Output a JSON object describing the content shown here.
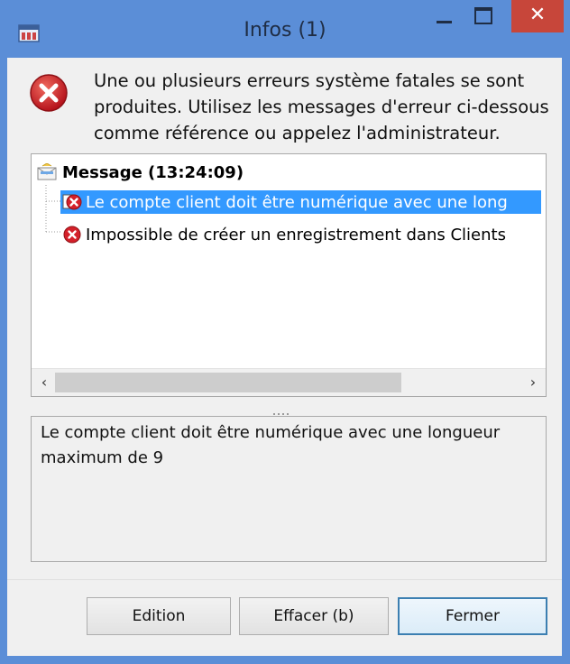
{
  "window": {
    "title": "Infos (1)",
    "close_glyph": "✕"
  },
  "header": {
    "message": "Une ou plusieurs erreurs système fatales se sont produites. Utilisez les messages d'erreur ci-dessous comme référence ou appelez l'administrateur."
  },
  "tree": {
    "root_label": "Message (13:24:09)",
    "items": [
      {
        "label": "Le compte client doit être numérique avec une long",
        "selected": true,
        "icon": "error-doc-icon"
      },
      {
        "label": "Impossible de créer un enregistrement dans Clients",
        "selected": false,
        "icon": "error-icon"
      }
    ],
    "scroll_left": "‹",
    "scroll_right": "›"
  },
  "detail": {
    "text": "Le compte client doit être numérique avec une longueur maximum de 9"
  },
  "buttons": {
    "edition": "Edition",
    "effacer": "Effacer (b)",
    "fermer": "Fermer"
  },
  "colors": {
    "titlebar": "#5b8ed7",
    "close": "#c7463a",
    "selection": "#3399ff",
    "error_red": "#d4202a"
  }
}
